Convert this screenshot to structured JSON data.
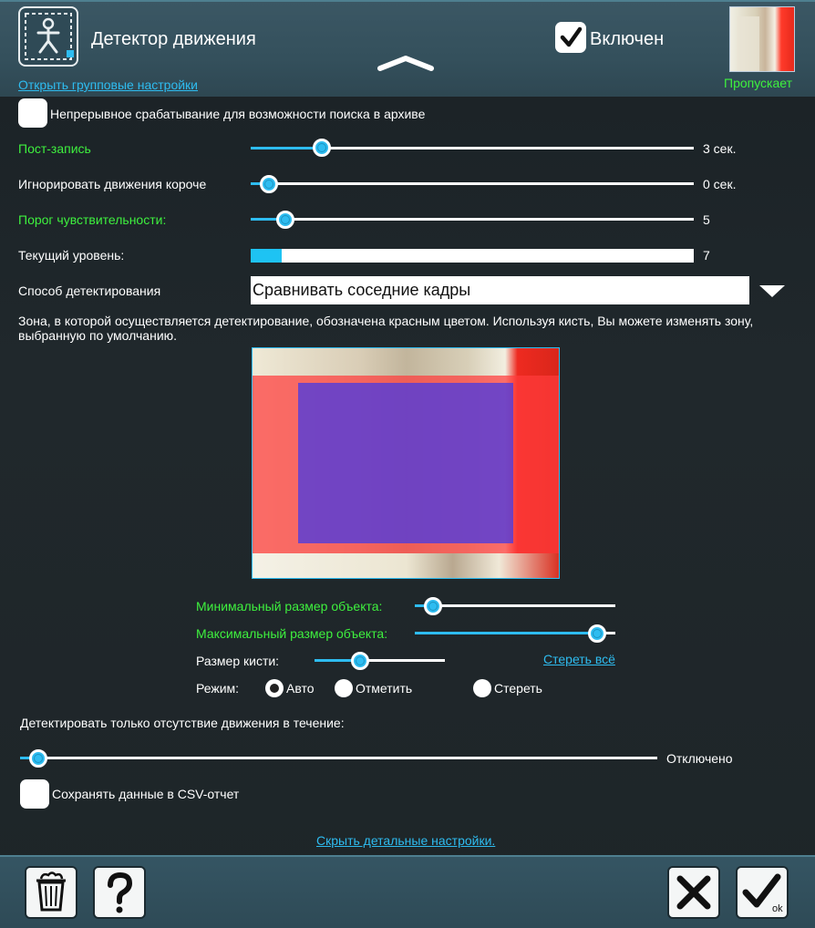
{
  "header": {
    "title": "Детектор движения",
    "enabled_label": "Включен",
    "group_settings_link": "Открыть групповые настройки",
    "preview_status": "Пропускает"
  },
  "continuous": {
    "label": "Непрерывное срабатывание для возможности поиска в архиве"
  },
  "rows": {
    "post_record": {
      "label": "Пост-запись",
      "value": "3 сек.",
      "level": 0.16
    },
    "ignore_short": {
      "label": "Игнорировать движения короче",
      "value": "0 сек.",
      "level": 0.04
    },
    "sensitivity": {
      "label": "Порог чувствительности:",
      "value": "5",
      "level": 0.08
    },
    "current_level": {
      "label": "Текущий уровень:",
      "value": "7",
      "level": 0.07
    }
  },
  "detection_method": {
    "label": "Способ детектирования",
    "selected": "Сравнивать соседние кадры"
  },
  "zone_hint": "Зона, в которой осуществляется детектирование, обозначена красным цветом. Используя кисть, Вы можете изменять зону, выбранную по умолчанию.",
  "zone_controls": {
    "min_size": {
      "label": "Минимальный размер объекта:",
      "level": 0.09
    },
    "max_size": {
      "label": "Максимальный размер объекта:",
      "level": 0.91
    },
    "brush_size": {
      "label": "Размер кисти:",
      "level": 0.35
    },
    "clear_all": "Стереть всё",
    "mode_label": "Режим:",
    "modes": [
      "Авто",
      "Отметить",
      "Стереть"
    ],
    "selected_mode": "Авто"
  },
  "absence": {
    "label": "Детектировать только отсутствие движения в течение:",
    "value": "Отключено",
    "level": 0.03
  },
  "csv": {
    "label": "Сохранять данные в CSV-отчет"
  },
  "hide_details_link": "Скрыть детальные настройки.",
  "colors": {
    "accent": "#2ebcf0",
    "green": "#3ef03e",
    "zone_red": "#ff4040",
    "zone_blue": "#5a3cd8"
  },
  "icons": [
    "motion-detector-icon",
    "checkmark-icon",
    "chevron-up-icon",
    "chevron-down-icon",
    "trash-icon",
    "help-icon",
    "close-icon",
    "ok-icon"
  ]
}
